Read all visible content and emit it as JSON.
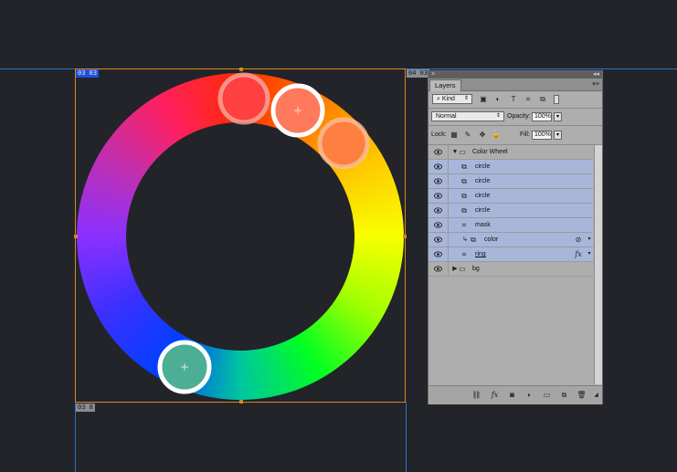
{
  "canvas": {
    "tags": {
      "top_left": "03 03",
      "top_right": "04 03",
      "bottom_left": "03 8"
    },
    "color_wheel": {
      "ring_colors": [
        "#ff2a00",
        "#ff7a00",
        "#ffc800",
        "#f8ff00",
        "#a0ff00",
        "#00ff22",
        "#00c6a0",
        "#0040ff",
        "#3a30ff",
        "#8a30ff",
        "#c030b0",
        "#ff2060",
        "#ff2a00"
      ],
      "markers": [
        {
          "name": "marker-top",
          "color": "#ff4040",
          "style": "faded"
        },
        {
          "name": "marker-active",
          "color": "#ff7a5c",
          "style": "active"
        },
        {
          "name": "marker-right",
          "color": "#ff7f40",
          "style": "faded"
        },
        {
          "name": "marker-bottom",
          "color": "#4cae94",
          "style": "active"
        }
      ]
    }
  },
  "layers_panel": {
    "collapse_glyph": "◂◂",
    "close_glyph": "×",
    "tab_label": "Layers",
    "filter_select": "Kind",
    "blend_mode": "Normal",
    "opacity_label": "Opacity:",
    "opacity_value": "100%",
    "lock_label": "Lock:",
    "fill_label": "Fill:",
    "fill_value": "100%",
    "layers": [
      {
        "name": "Color Wheel",
        "type": "group-open",
        "highlighted": false
      },
      {
        "name": "circle",
        "type": "smart",
        "highlighted": true
      },
      {
        "name": "circle",
        "type": "smart",
        "highlighted": true
      },
      {
        "name": "circle",
        "type": "smart",
        "highlighted": true
      },
      {
        "name": "circle",
        "type": "smart",
        "highlighted": true
      },
      {
        "name": "mask",
        "type": "shape",
        "highlighted": true
      },
      {
        "name": "color",
        "type": "clipped-smart",
        "highlighted": true,
        "badge": "link"
      },
      {
        "name": "ring",
        "type": "shape",
        "highlighted": true,
        "badge": "fx"
      },
      {
        "name": "bg",
        "type": "group-closed",
        "highlighted": false
      }
    ]
  }
}
